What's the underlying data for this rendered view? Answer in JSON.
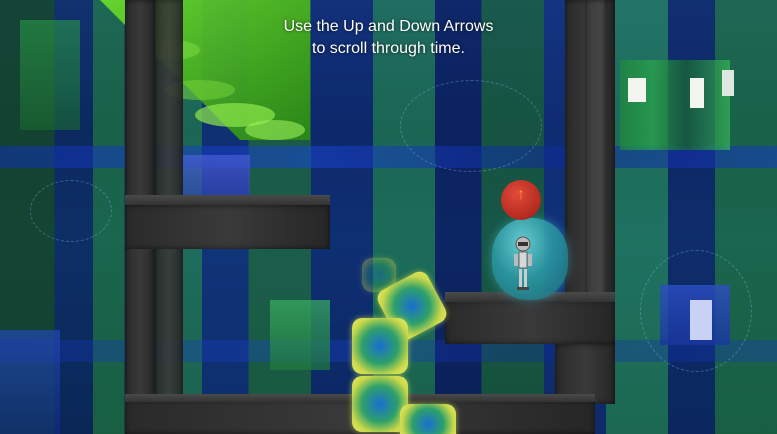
{
  "hud": {
    "instruction_line1": "Use the Up and Down Arrows",
    "instruction_line2": "to scroll through time."
  },
  "player": {
    "time_indicator_icon": "up-arrow-icon",
    "time_indicator_glyph": "↑"
  },
  "colors": {
    "wall": "#333333",
    "cube_edge": "#e6ec6a",
    "cube_core": "#1a6fd0",
    "capsule": "#2c9aa6",
    "time_orb": "#c0301f",
    "time_arrow": "#f2a020",
    "tree": "#3fbf1a"
  }
}
